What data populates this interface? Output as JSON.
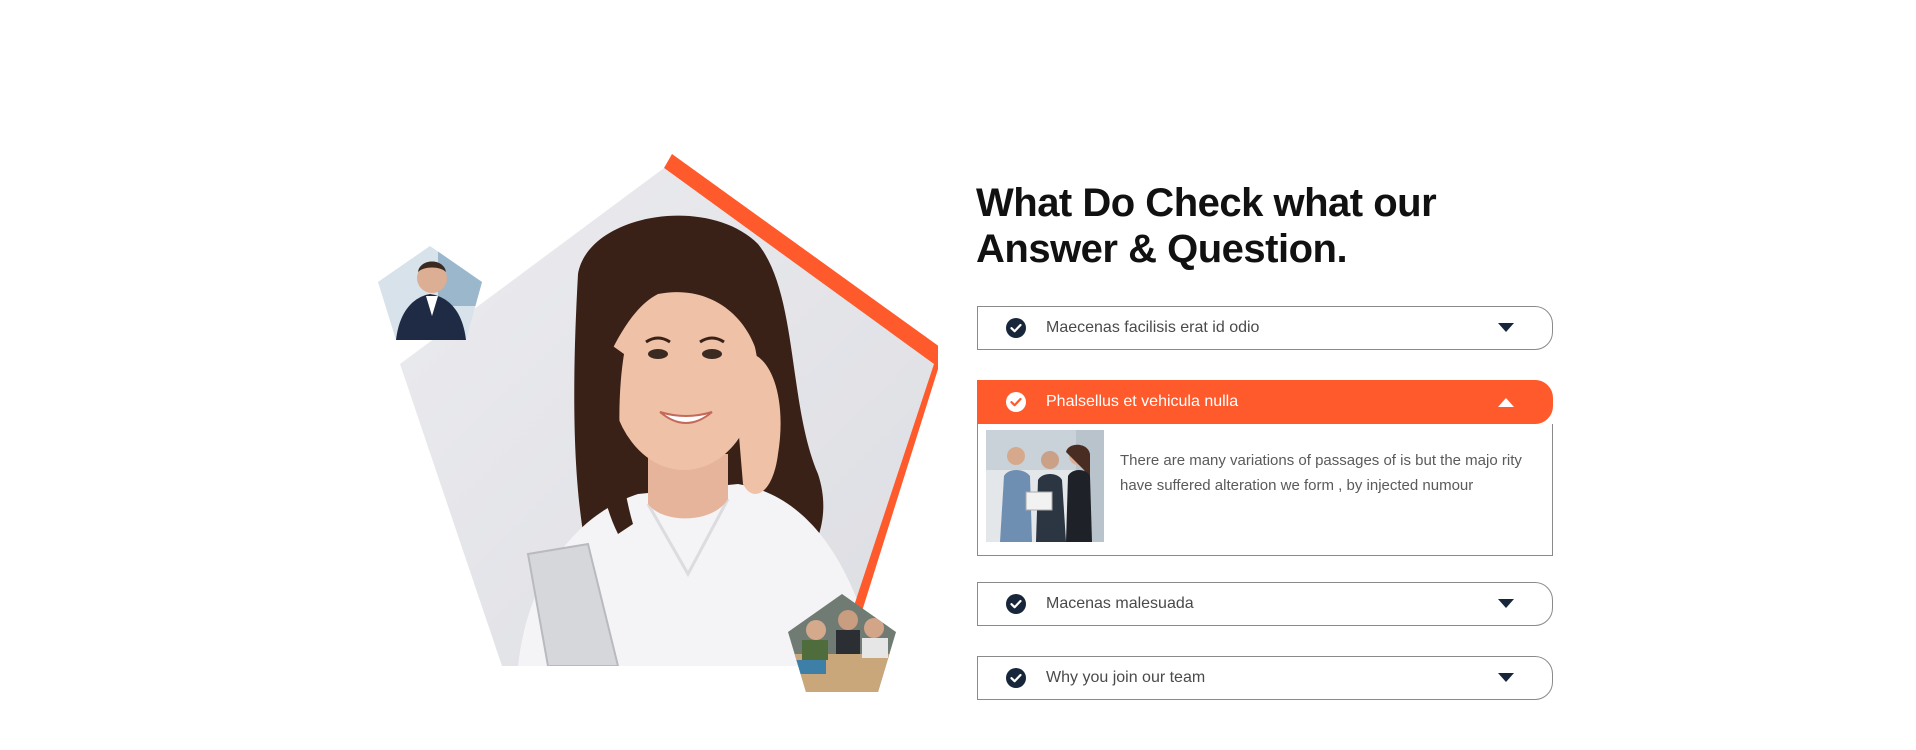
{
  "section": {
    "heading_line1": "What Do Check what our",
    "heading_line2": "Answer & Question."
  },
  "colors": {
    "accent": "#ff5a2c",
    "check_dark": "#17263a",
    "border": "#8a8a8a"
  },
  "faq": {
    "items": [
      {
        "label": "Maecenas facilisis erat id odio",
        "expanded": false,
        "icon": "chevron-down-icon"
      },
      {
        "label": "Phalsellus et vehicula nulla",
        "expanded": true,
        "icon": "chevron-up-icon",
        "body_text": "There are many variations of passages of is but the majo rity have suffered alteration we form , by injected numour"
      },
      {
        "label": "Macenas malesuada",
        "expanded": false,
        "icon": "chevron-down-icon"
      },
      {
        "label": "Why you join our team",
        "expanded": false,
        "icon": "chevron-down-icon"
      }
    ]
  }
}
